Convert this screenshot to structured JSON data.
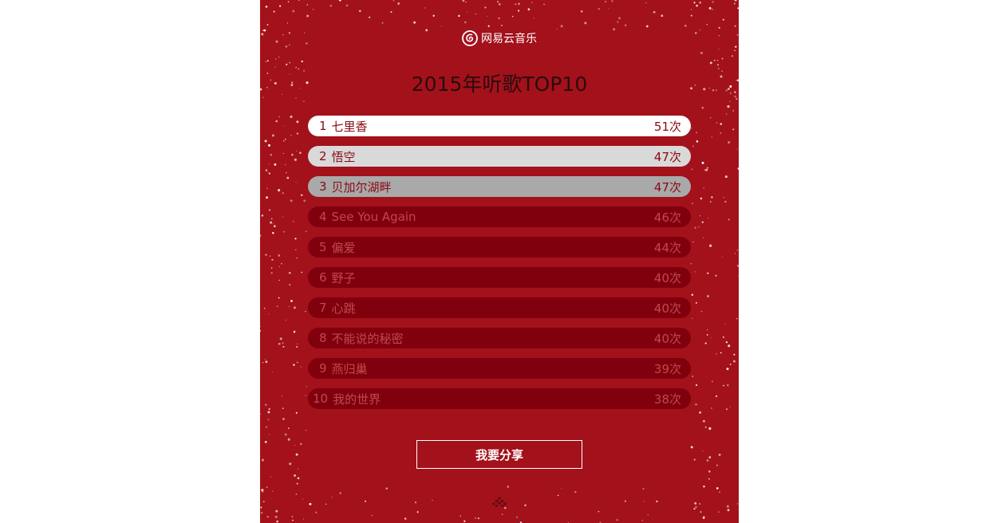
{
  "brand": {
    "logo_icon": "netease-music-icon",
    "name": "网易云音乐"
  },
  "title": "2015年听歌TOP10",
  "songs": [
    {
      "rank": "1",
      "name": "七里香",
      "count": "51次"
    },
    {
      "rank": "2",
      "name": "悟空",
      "count": "47次"
    },
    {
      "rank": "3",
      "name": "贝加尔湖畔",
      "count": "47次"
    },
    {
      "rank": "4",
      "name": "See You Again",
      "count": "46次"
    },
    {
      "rank": "5",
      "name": "偏爱",
      "count": "44次"
    },
    {
      "rank": "6",
      "name": "野子",
      "count": "40次"
    },
    {
      "rank": "7",
      "name": "心跳",
      "count": "40次"
    },
    {
      "rank": "8",
      "name": "不能说的秘密",
      "count": "40次"
    },
    {
      "rank": "9",
      "name": "燕归巢",
      "count": "39次"
    },
    {
      "rank": "10",
      "name": "我的世界",
      "count": "38次"
    }
  ],
  "share_button": "我要分享",
  "scroll_hint_icon": "up-arrow-dots-icon",
  "colors": {
    "background": "#a3111b",
    "row_first": "#ffffff",
    "row_second": "#d9d9d9",
    "row_third": "#a9a9a9",
    "row_rest": "#80000d",
    "text_top": "#8a0a12",
    "text_rest": "#c0484f"
  }
}
